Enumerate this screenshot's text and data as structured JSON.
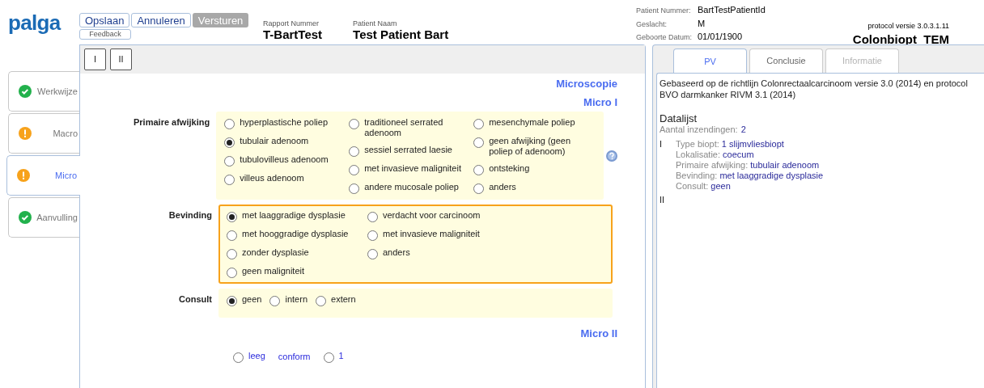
{
  "header": {
    "logo": "palga",
    "buttons": [
      {
        "label": "Opslaan",
        "disabled": false
      },
      {
        "label": "Annuleren",
        "disabled": false
      },
      {
        "label": "Versturen",
        "disabled": true
      }
    ],
    "feedback": "Feedback",
    "report": [
      {
        "label": "Rapport Nummer",
        "value": "T-BartTest"
      },
      {
        "label": "Patient Naam",
        "value": "Test Patient Bart"
      }
    ],
    "patient": [
      {
        "label": "Patient Nummer:",
        "value": "BartTestPatientId"
      },
      {
        "label": "Geslacht:",
        "value": "M"
      },
      {
        "label": "Geboorte Datum:",
        "value": "01/01/1900"
      }
    ],
    "protocol_version": "protocol versie 3.0.3.1.11",
    "protocol_name": "Colonbiopt_TEM"
  },
  "sidebar": [
    {
      "label": "Werkwijze",
      "kind": "complete",
      "selected": false
    },
    {
      "label": "Macro",
      "kind": "warning",
      "selected": false
    },
    {
      "label": "Micro",
      "kind": "warning",
      "selected": true
    },
    {
      "label": "Aanvulling",
      "kind": "complete",
      "selected": false
    }
  ],
  "toolbar": [
    "I",
    "II"
  ],
  "section_title": "Microscopie",
  "subsection_title": "Micro I",
  "fields": [
    {
      "label": "Primaire afwijking",
      "kind": "grid",
      "focused": false,
      "help": true,
      "columns": [
        [
          {
            "label": "hyperplastische poliep",
            "selected": false
          },
          {
            "label": "tubulair adenoom",
            "selected": true
          },
          {
            "label": "tubulovilleus adenoom",
            "selected": false
          },
          {
            "label": "villeus adenoom",
            "selected": false
          }
        ],
        [
          {
            "label": "traditioneel serrated adenoom",
            "selected": false
          },
          {
            "label": "sessiel serrated laesie",
            "selected": false
          },
          {
            "label": "met invasieve maligniteit",
            "selected": false
          },
          {
            "label": "andere mucosale poliep",
            "selected": false
          }
        ],
        [
          {
            "label": "mesenchymale poliep",
            "selected": false
          },
          {
            "label": "geen afwijking (geen poliep of adenoom)",
            "selected": false
          },
          {
            "label": "ontsteking",
            "selected": false
          },
          {
            "label": "anders",
            "selected": false
          }
        ]
      ]
    },
    {
      "label": "Bevinding",
      "kind": "grid",
      "focused": true,
      "help": false,
      "columns": [
        [
          {
            "label": "met laaggradige dysplasie",
            "selected": true
          },
          {
            "label": "met hooggradige dysplasie",
            "selected": false
          },
          {
            "label": "zonder dysplasie",
            "selected": false
          },
          {
            "label": "geen maligniteit",
            "selected": false
          }
        ],
        [
          {
            "label": "verdacht voor carcinoom",
            "selected": false
          },
          {
            "label": "met invasieve maligniteit",
            "selected": false
          },
          {
            "label": "anders",
            "selected": false
          }
        ]
      ]
    },
    {
      "label": "Consult",
      "kind": "inline",
      "focused": false,
      "help": false,
      "columns": [
        [
          {
            "label": "geen",
            "selected": true
          },
          {
            "label": "intern",
            "selected": false
          },
          {
            "label": "extern",
            "selected": false
          }
        ]
      ]
    }
  ],
  "subsection2_title": "Micro II",
  "micro2_row": [
    {
      "kind": "radio",
      "label": "leeg",
      "selected": false
    },
    {
      "kind": "link",
      "label": "conform"
    },
    {
      "kind": "radio",
      "label": "1",
      "selected": false
    }
  ],
  "right_tabs": [
    {
      "label": "PV",
      "selected": true,
      "disabled": false
    },
    {
      "label": "Conclusie",
      "selected": false,
      "disabled": false
    },
    {
      "label": "Informatie",
      "selected": false,
      "disabled": true
    }
  ],
  "pv": {
    "intro": "Gebaseerd op de richtlijn Colonrectaalcarcinoom versie 3.0 (2014) en protocol BVO darmkanker RIVM 3.1 (2014)",
    "title": "Datalijst",
    "count_label": "Aantal inzendingen:",
    "count": "2",
    "groups": [
      {
        "label": "I",
        "items": [
          {
            "label": "Type biopt:",
            "value": "1 slijmvliesbiopt"
          },
          {
            "label": "Lokalisatie:",
            "value": "coecum"
          },
          {
            "label": "Primaire afwijking:",
            "value": "tubulair adenoom"
          },
          {
            "label": "Bevinding:",
            "value": "met laaggradige dysplasie"
          },
          {
            "label": "Consult:",
            "value": "geen"
          }
        ]
      },
      {
        "label": "II"
      }
    ]
  }
}
